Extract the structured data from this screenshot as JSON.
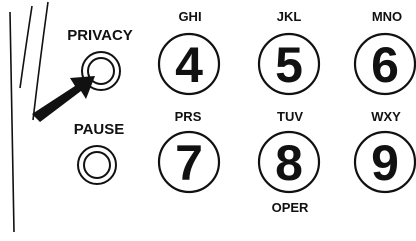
{
  "side_buttons": [
    {
      "label": "PRIVACY"
    },
    {
      "label": "PAUSE"
    }
  ],
  "keys": [
    {
      "digit": "4",
      "letters": "GHI"
    },
    {
      "digit": "5",
      "letters": "JKL"
    },
    {
      "digit": "6",
      "letters": "MNO"
    },
    {
      "digit": "7",
      "letters": "PRS"
    },
    {
      "digit": "8",
      "letters": "TUV"
    },
    {
      "digit": "9",
      "letters": "WXY"
    }
  ],
  "sub_label_8": "OPER",
  "colors": {
    "ink": "#111111",
    "background": "#ffffff"
  },
  "icons": {
    "pointer": "arrow-icon"
  }
}
